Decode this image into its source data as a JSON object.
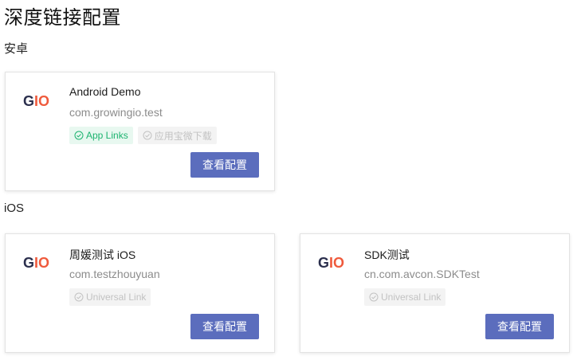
{
  "page": {
    "title": "深度链接配置"
  },
  "sections": {
    "android": {
      "title": "安卓"
    },
    "ios": {
      "title": "iOS"
    }
  },
  "colors": {
    "button": "#5b6dbd",
    "active_tag": "#1cb36f",
    "logo_dark": "#2b2f4d",
    "logo_accent": "#ef5a3c"
  },
  "logo": {
    "text_g": "G",
    "text_io": "IO"
  },
  "cards": [
    {
      "app_name": "Android Demo",
      "package": "com.growingio.test",
      "tags": [
        {
          "label": "App Links",
          "state": "active",
          "icon": "check-circle-icon"
        },
        {
          "label": "应用宝微下载",
          "state": "disabled",
          "icon": "check-circle-icon"
        }
      ],
      "button_label": "查看配置"
    },
    {
      "app_name": "周媛测试 iOS",
      "package": "com.testzhouyuan",
      "tags": [
        {
          "label": "Universal Link",
          "state": "disabled",
          "icon": "check-circle-icon"
        }
      ],
      "button_label": "查看配置"
    },
    {
      "app_name": "SDK测试",
      "package": "cn.com.avcon.SDKTest",
      "tags": [
        {
          "label": "Universal Link",
          "state": "disabled",
          "icon": "check-circle-icon"
        }
      ],
      "button_label": "查看配置"
    }
  ]
}
